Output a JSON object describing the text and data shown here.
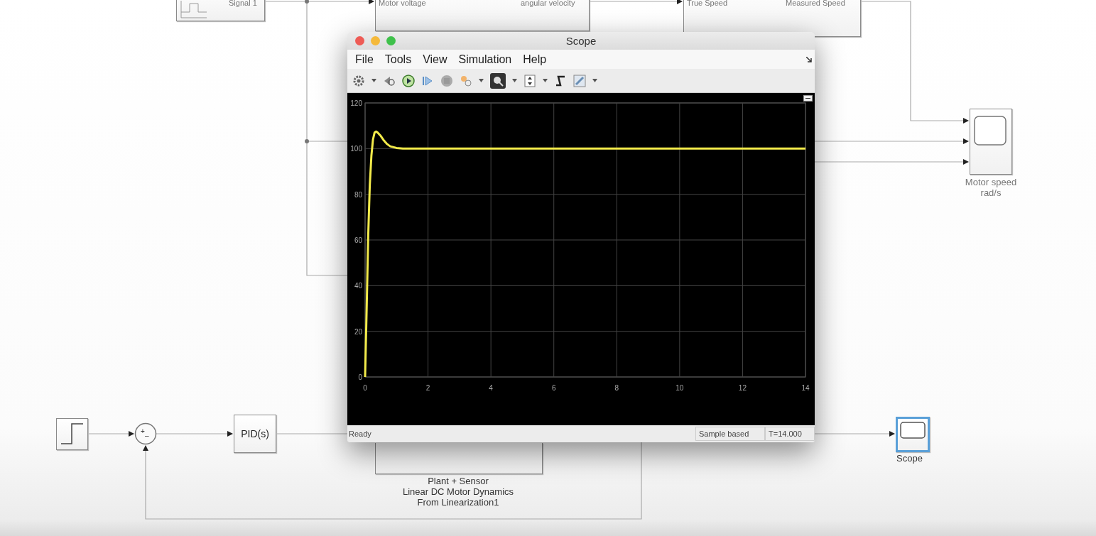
{
  "model": {
    "signal_block": {
      "label": "Signal 1"
    },
    "motor_block": {
      "input_port": "Motor voltage",
      "output_port": "angular velocity"
    },
    "sensor_block": {
      "input_port": "True Speed",
      "output_port": "Measured Speed"
    },
    "speed_scope": {
      "caption_lines": [
        "Motor speed",
        "rad/s"
      ]
    },
    "sum_block": {
      "signs": [
        "+",
        "–"
      ]
    },
    "pid_block": {
      "label": "PID(s)"
    },
    "plant_block": {
      "caption_lines": [
        "Plant + Sensor",
        "Linear DC Motor Dynamics",
        "From Linearization1"
      ]
    },
    "scope_block": {
      "label": "Scope",
      "selected": true
    }
  },
  "scope_window": {
    "title": "Scope",
    "menu": [
      "File",
      "Tools",
      "View",
      "Simulation",
      "Help"
    ],
    "chart_data": {
      "type": "line",
      "x": [
        0,
        0.05,
        0.1,
        0.15,
        0.2,
        0.25,
        0.3,
        0.35,
        0.4,
        0.5,
        0.6,
        0.7,
        0.8,
        1,
        1.2,
        1.5,
        2,
        4,
        6,
        8,
        10,
        12,
        14
      ],
      "grid": true,
      "series": [
        {
          "color": "#f2ea4a",
          "values": [
            0,
            30,
            62,
            84,
            97,
            104,
            107,
            107.5,
            107,
            105.5,
            103.5,
            102,
            101,
            100.3,
            100,
            100,
            100,
            100,
            100,
            100,
            100,
            100,
            100
          ]
        }
      ],
      "xlim": [
        0,
        14
      ],
      "ylim": [
        0,
        120
      ],
      "xticks": [
        0,
        2,
        4,
        6,
        8,
        10,
        12,
        14
      ],
      "yticks": [
        0,
        20,
        40,
        60,
        80,
        100,
        120
      ]
    },
    "status": {
      "message": "Ready",
      "mode": "Sample based",
      "time": "T=14.000"
    }
  }
}
